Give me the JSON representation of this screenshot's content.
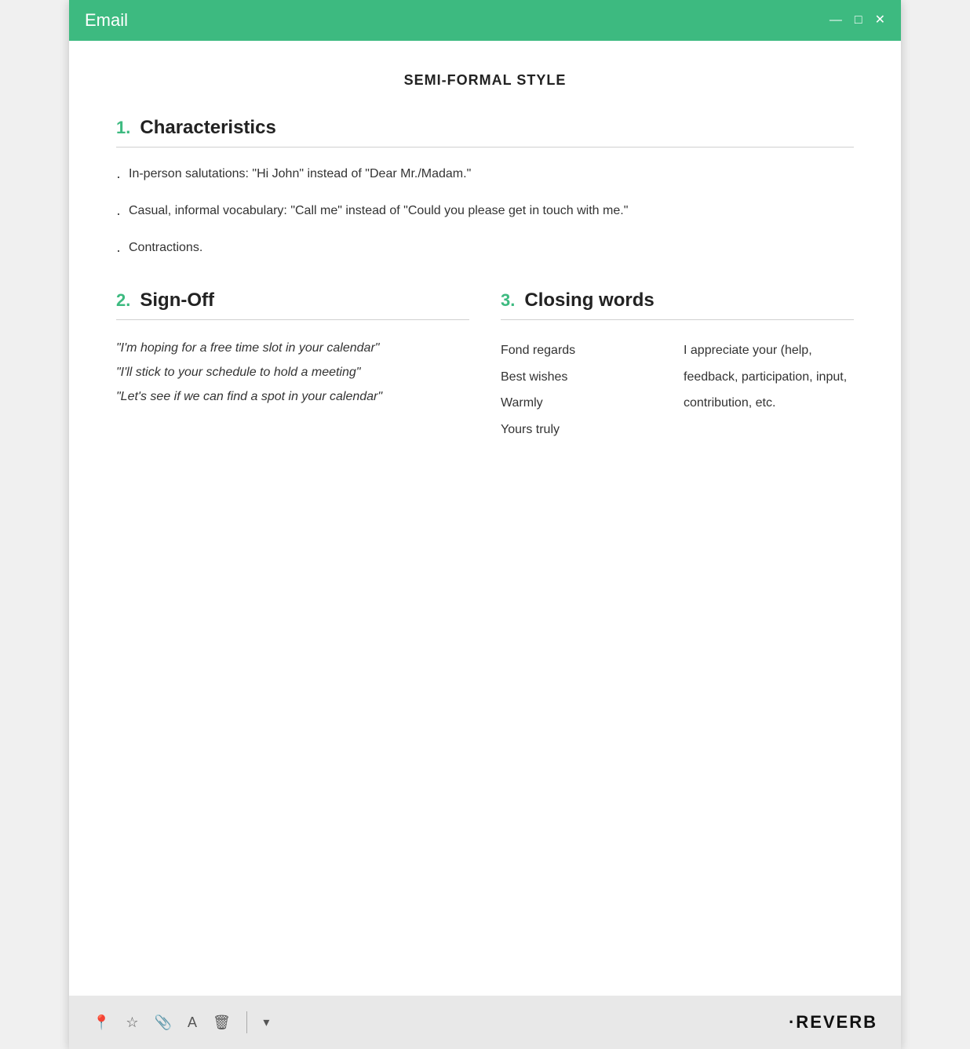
{
  "titlebar": {
    "title": "Email",
    "minimize": "—",
    "maximize": "□",
    "close": "✕"
  },
  "page": {
    "title": "SEMI-FORMAL STYLE"
  },
  "section1": {
    "number": "1.",
    "title": "Characteristics",
    "bullets": [
      "In-person salutations: \"Hi John\" instead of \"Dear Mr./Madam.\"",
      "Casual, informal vocabulary: \"Call me\" instead of \"Could you please get in touch with me.\"",
      "Contractions."
    ]
  },
  "section2": {
    "number": "2.",
    "title": "Sign-Off",
    "quotes": [
      "\"I'm hoping for a free time slot in your calendar\"",
      "\"I'll stick to your schedule to hold a meeting\"",
      "\"Let's see if we can find a spot in your calendar\""
    ]
  },
  "section3": {
    "number": "3.",
    "title": "Closing words",
    "left_words": [
      "Fond regards",
      "Best wishes",
      "Warmly",
      "Yours truly"
    ],
    "right_text": "I appreciate your (help, feedback, participation, input, contribution, etc."
  },
  "footer": {
    "logo": "·REVERB"
  }
}
